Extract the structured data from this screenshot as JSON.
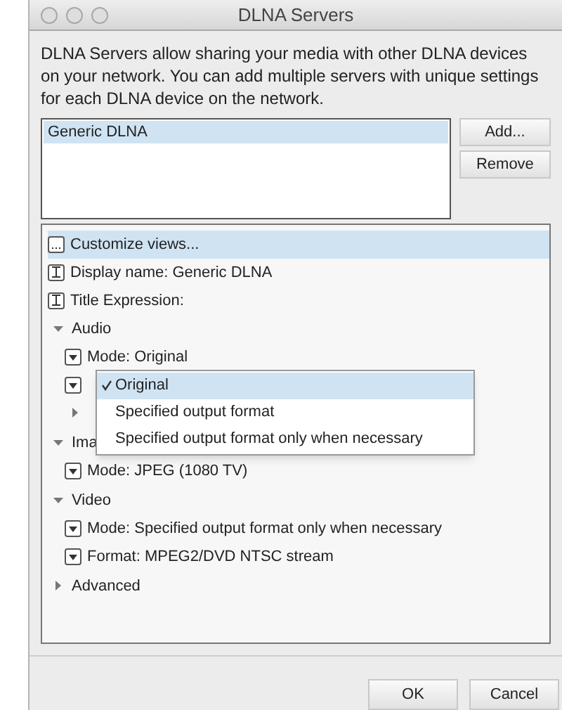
{
  "window": {
    "title": "DLNA Servers"
  },
  "description": "DLNA Servers allow sharing your media with other DLNA devices on your network.  You can add multiple servers with unique settings for each DLNA device on the network.",
  "servers": [
    {
      "label": "Generic DLNA",
      "selected": true
    }
  ],
  "server_buttons": [
    "Add...",
    "Remove"
  ],
  "tree": [
    {
      "kind": "button",
      "label": "Customize views...",
      "selected": true
    },
    {
      "kind": "text",
      "label": "Display name: Generic DLNA",
      "selected": false
    },
    {
      "kind": "text",
      "label": "Title Expression:",
      "selected": false
    },
    {
      "kind": "group",
      "label": "Audio",
      "expanded": true,
      "selected": false,
      "children": [
        {
          "kind": "dropdown",
          "label": "Mode: Original",
          "selected": false
        },
        {
          "kind": "dropdown",
          "selected": false
        },
        {
          "kind": "group",
          "expanded": false,
          "selected": false
        }
      ]
    },
    {
      "kind": "group",
      "label": "Ima",
      "expanded": true,
      "selected": false,
      "children": [
        {
          "kind": "dropdown",
          "label": "Mode: JPEG (1080 TV)",
          "selected": false
        }
      ]
    },
    {
      "kind": "group",
      "label": "Video",
      "expanded": true,
      "selected": false,
      "children": [
        {
          "kind": "dropdown",
          "label": "Mode: Specified output format only when necessary",
          "selected": false
        },
        {
          "kind": "dropdown",
          "label": "Format: MPEG2/DVD NTSC stream",
          "selected": false
        }
      ]
    },
    {
      "kind": "group",
      "label": "Advanced",
      "expanded": false,
      "selected": false
    }
  ],
  "popup_menu": [
    {
      "label": "Original",
      "selected": true
    },
    {
      "label": "Specified output format",
      "selected": false
    },
    {
      "label": "Specified output format only when necessary",
      "selected": false
    }
  ],
  "dialog_buttons": [
    "OK",
    "Cancel"
  ]
}
